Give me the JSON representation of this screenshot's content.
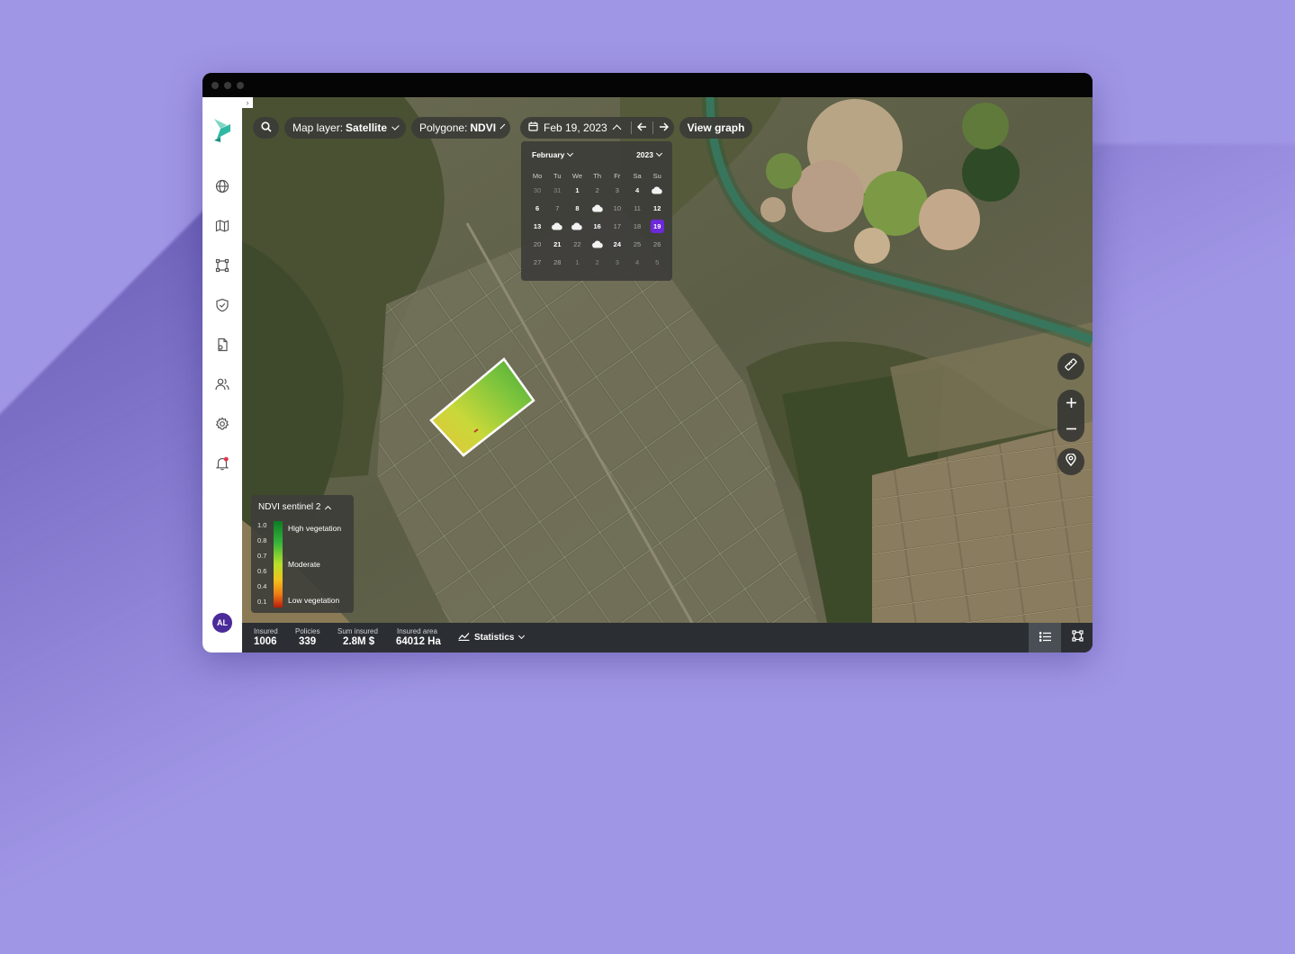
{
  "toolbar": {
    "map_layer_label": "Map layer:",
    "map_layer_value": "Satellite",
    "polygone_label": "Polygone:",
    "polygone_value": "NDVI",
    "date": "Feb 19, 2023",
    "view_graph_label": "View graph"
  },
  "calendar": {
    "month": "February",
    "year": "2023",
    "weekdays": [
      "Mo",
      "Tu",
      "We",
      "Th",
      "Fr",
      "Sa",
      "Su"
    ],
    "weeks": [
      [
        {
          "d": "30",
          "s": "dim"
        },
        {
          "d": "31",
          "s": "dim"
        },
        {
          "d": "1",
          "s": "bold"
        },
        {
          "d": "2",
          "s": "muted"
        },
        {
          "d": "3",
          "s": "muted"
        },
        {
          "d": "4",
          "s": "bold"
        },
        {
          "d": "",
          "s": "cloud"
        }
      ],
      [
        {
          "d": "6",
          "s": "bold"
        },
        {
          "d": "7",
          "s": "muted"
        },
        {
          "d": "8",
          "s": "bold"
        },
        {
          "d": "",
          "s": "cloud"
        },
        {
          "d": "10",
          "s": "muted"
        },
        {
          "d": "11",
          "s": "muted"
        },
        {
          "d": "12",
          "s": "bold"
        }
      ],
      [
        {
          "d": "13",
          "s": "bold"
        },
        {
          "d": "",
          "s": "cloud"
        },
        {
          "d": "",
          "s": "cloud"
        },
        {
          "d": "16",
          "s": "bold"
        },
        {
          "d": "17",
          "s": "muted"
        },
        {
          "d": "18",
          "s": "muted"
        },
        {
          "d": "19",
          "s": "sel"
        }
      ],
      [
        {
          "d": "20",
          "s": "muted"
        },
        {
          "d": "21",
          "s": "bold"
        },
        {
          "d": "22",
          "s": "muted"
        },
        {
          "d": "",
          "s": "cloud"
        },
        {
          "d": "24",
          "s": "bold"
        },
        {
          "d": "25",
          "s": "muted"
        },
        {
          "d": "26",
          "s": "muted"
        }
      ],
      [
        {
          "d": "27",
          "s": "muted"
        },
        {
          "d": "28",
          "s": "muted"
        },
        {
          "d": "1",
          "s": "dim"
        },
        {
          "d": "2",
          "s": "dim"
        },
        {
          "d": "3",
          "s": "dim"
        },
        {
          "d": "4",
          "s": "dim"
        },
        {
          "d": "5",
          "s": "dim"
        }
      ]
    ],
    "selected_color": "#6d28d9"
  },
  "legend": {
    "title": "NDVI sentinel 2",
    "ticks": [
      "1.0",
      "0.8",
      "0.7",
      "0.6",
      "0.4",
      "0.1"
    ],
    "labels": [
      "High vegetation",
      "Moderate",
      "Low vegetation"
    ]
  },
  "sidebar": {
    "items": [
      "globe-icon",
      "map-icon",
      "polygon-icon",
      "shield-icon",
      "file-icon",
      "users-icon",
      "settings-icon",
      "bell-icon"
    ],
    "avatar": "AL",
    "brand_color": "#2fb9a5"
  },
  "status": {
    "insured_label": "Insured",
    "insured_value": "1006",
    "policies_label": "Policies",
    "policies_value": "339",
    "sum_label": "Sum insured",
    "sum_value": "2.8M $",
    "area_label": "Insured area",
    "area_value": "64012 Ha",
    "statistics_label": "Statistics"
  }
}
